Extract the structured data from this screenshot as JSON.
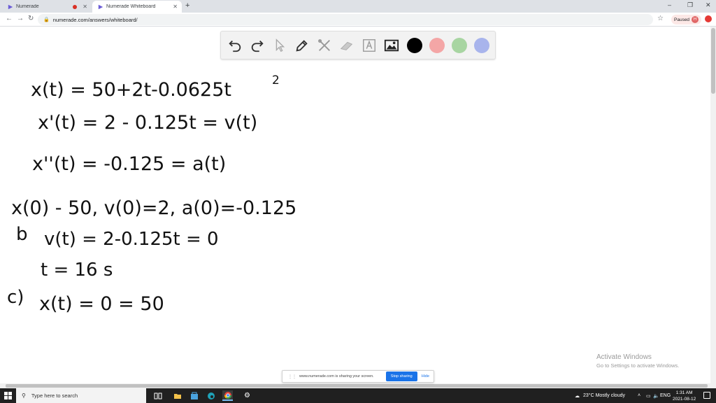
{
  "browser": {
    "tabs": [
      {
        "title": "Numerade",
        "active": false
      },
      {
        "title": "Numerade Whiteboard",
        "active": true
      }
    ],
    "new_tab": "+",
    "window_controls": {
      "minimize": "–",
      "maximize": "❐",
      "close": "✕"
    },
    "nav": {
      "back": "←",
      "forward": "→",
      "reload": "↻"
    },
    "address": "numerade.com/answers/whiteboard/",
    "profile": {
      "label": "Paused",
      "initial": "H"
    }
  },
  "whiteboard": {
    "tools": [
      "undo-icon",
      "redo-icon",
      "pointer-icon",
      "pen-icon",
      "tools-icon",
      "eraser-icon",
      "text-icon",
      "image-icon"
    ],
    "colors": {
      "black": "#000000",
      "red": "#f4a6a6",
      "green": "#a8d5a2",
      "blue": "#a8b4ec"
    },
    "handwriting": {
      "line1": "x(t) = 50+2t-0.0625t",
      "line1_exp": "2",
      "line2": "x'(t) = 2 - 0.125t = v(t)",
      "line3": "x''(t) = -0.125  = a(t)",
      "line4": "x(0) - 50,  v(0)=2,  a(0)=-0.125",
      "line5_label": "b",
      "line5": "v(t) = 2-0.125t = 0",
      "line6": "t = 16 s",
      "line7_label": "c)",
      "line7": "x(t) = 0 = 50"
    }
  },
  "watermark": {
    "title": "Activate Windows",
    "subtitle": "Go to Settings to activate Windows."
  },
  "share_bar": {
    "message": "www.numerade.com is sharing your screen.",
    "stop": "Stop sharing",
    "hide": "Hide"
  },
  "taskbar": {
    "search_placeholder": "Type here to search",
    "weather": "23°C  Mostly cloudy",
    "language": "ENG",
    "time": "1:31 AM",
    "date": "2021-08-12"
  }
}
